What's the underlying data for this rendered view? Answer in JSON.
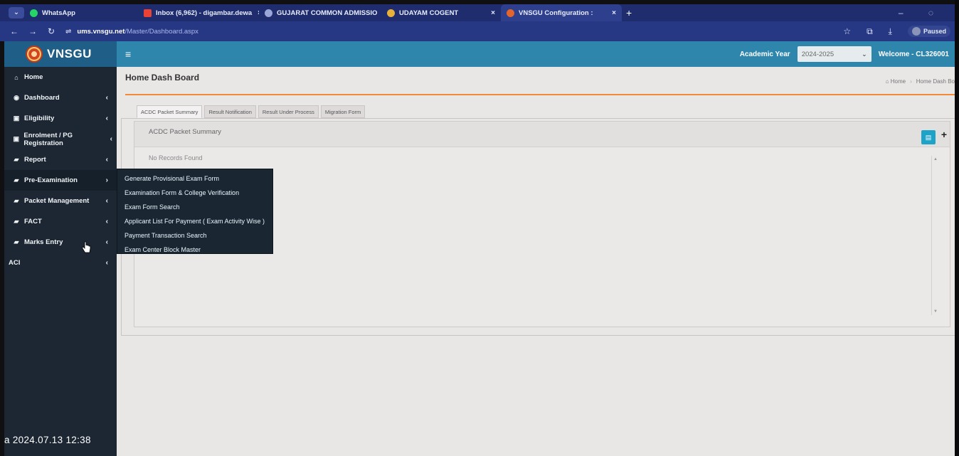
{
  "browser": {
    "tabs": [
      {
        "label": "WhatsApp",
        "fav_color": "#25d366",
        "close": ""
      },
      {
        "label": "Inbox (6,962) - digambar.dewa",
        "fav_color": "#ea4335",
        "close": "×"
      },
      {
        "label": "GUJARAT COMMON ADMISSIO",
        "fav_color": "#9aa5d8",
        "close": "×"
      },
      {
        "label": "UDAYAM COGENT",
        "fav_color": "#e8b23a",
        "close": "×"
      },
      {
        "label": "VNSGU Configuration :",
        "fav_color": "#e2652b",
        "close": "×"
      }
    ],
    "new_tab": "+",
    "url_host": "ums.vnsgu.net",
    "url_path": "/Master/Dashboard.aspx",
    "profile_status": "Paused"
  },
  "header": {
    "brand": "VNSGU",
    "hamburger": "≡",
    "academic_year_label": "Academic Year",
    "academic_year_value": "2024-2025",
    "welcome": "Welcome - CL326001"
  },
  "sidebar": {
    "items": [
      {
        "label": "Home",
        "icon": "⌂",
        "chevron": ""
      },
      {
        "label": "Dashboard",
        "icon": "◉",
        "chevron": "‹"
      },
      {
        "label": "Eligibility",
        "icon": "▣",
        "chevron": "‹"
      },
      {
        "label": "Enrolment / PG Registration",
        "icon": "▣",
        "chevron": "‹"
      },
      {
        "label": "Report",
        "icon": "▰",
        "chevron": "‹"
      },
      {
        "label": "Pre-Examination",
        "icon": "▰",
        "chevron": "›"
      },
      {
        "label": "Packet Management",
        "icon": "▰",
        "chevron": "‹"
      },
      {
        "label": "FACT",
        "icon": "▰",
        "chevron": "‹"
      },
      {
        "label": "Marks Entry",
        "icon": "▰",
        "chevron": "‹"
      },
      {
        "label": "ACI",
        "icon": "",
        "chevron": "‹"
      }
    ]
  },
  "flyout": {
    "items": [
      "Generate Provisional Exam Form",
      "Examination Form & College Verification",
      "Exam Form Search",
      "Applicant List For Payment ( Exam Activity Wise )",
      "Payment Transaction Search",
      "Exam Center Block Master"
    ]
  },
  "content": {
    "page_title": "Home Dash Board",
    "breadcrumb_home": "Home",
    "breadcrumb_current": "Home Dash Bo",
    "tabs": [
      "ACDC Packet Summary",
      "Result Notification",
      "Result Under Process",
      "Migration Form"
    ],
    "panel_title": "ACDC Packet Summary",
    "empty_message": "No Records Found",
    "plus": "+"
  },
  "photo_timestamp": "a  2024.07.13 12:38"
}
